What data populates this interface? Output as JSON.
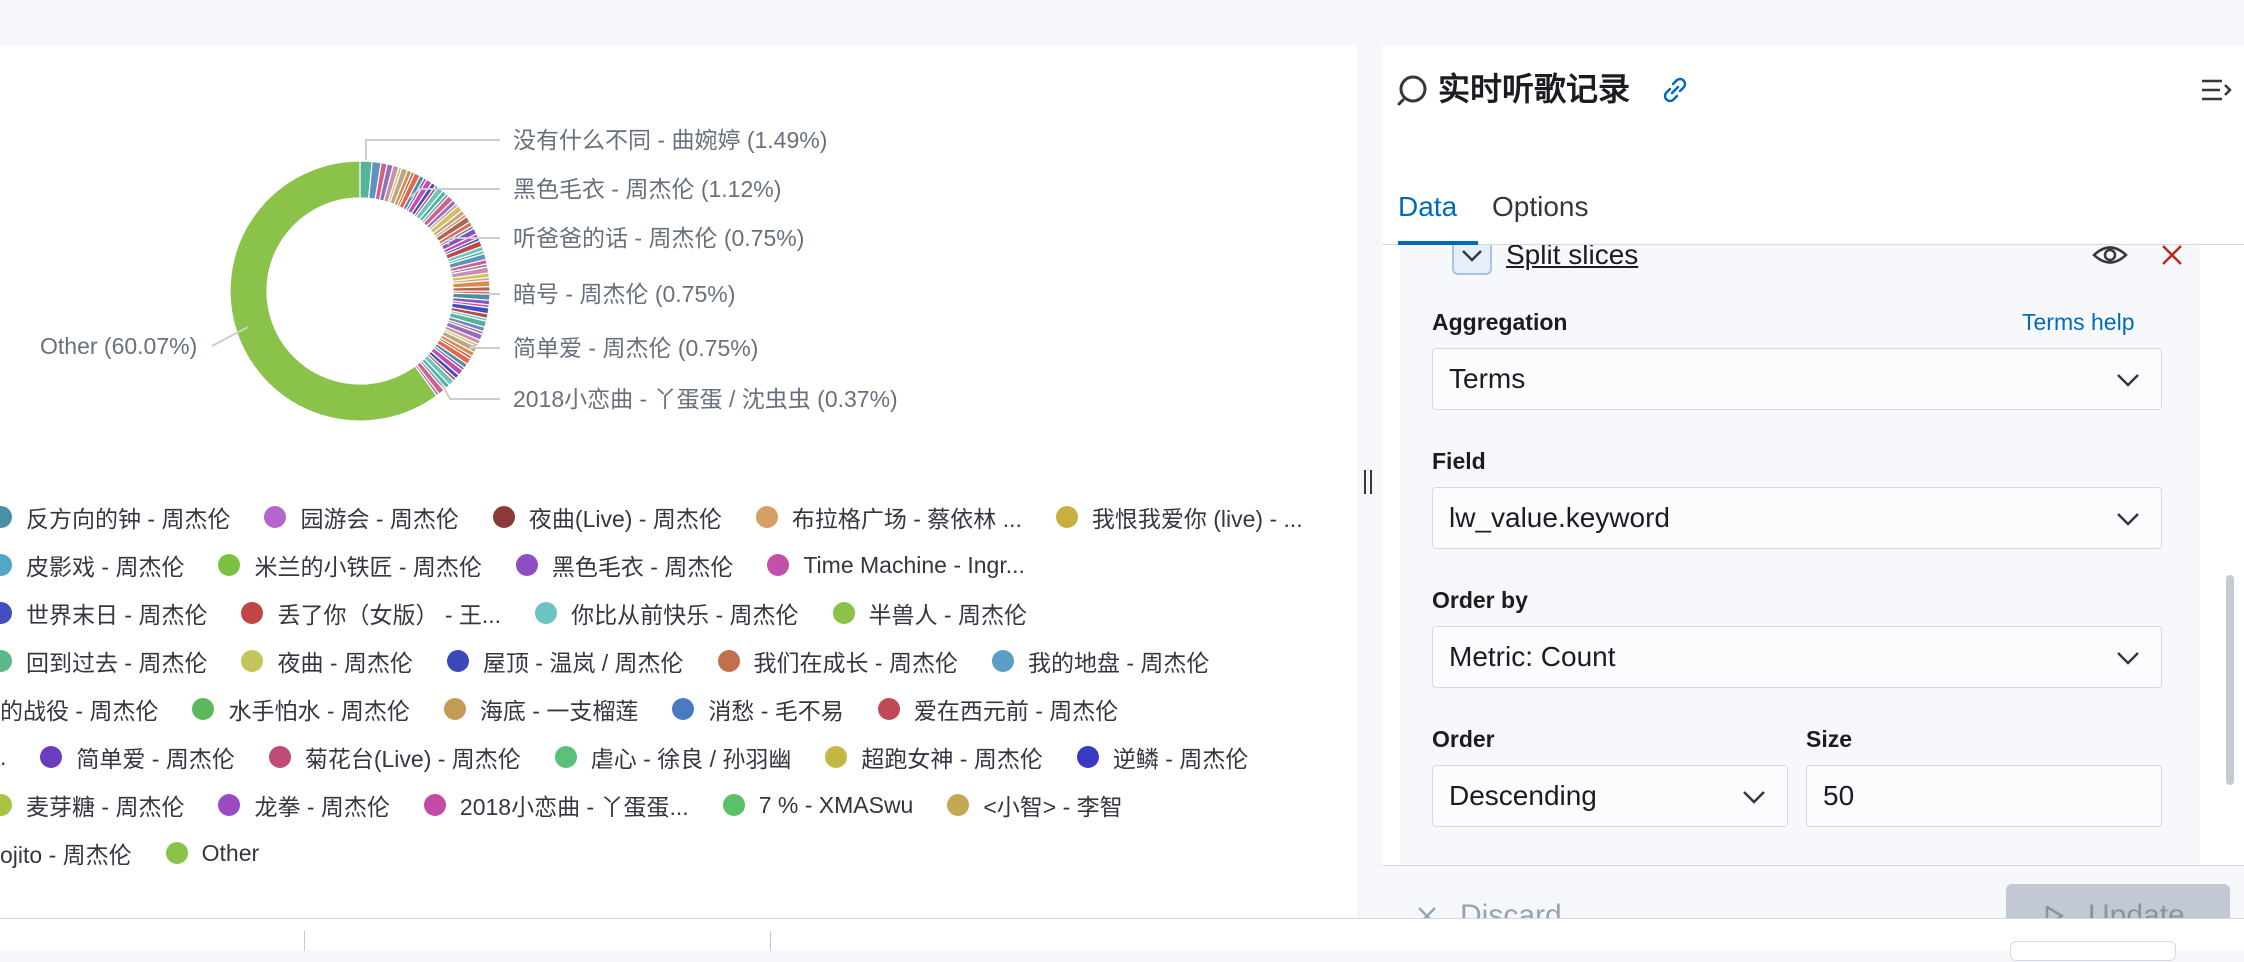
{
  "header": {
    "title": "实时听歌记录"
  },
  "tabs": [
    {
      "label": "Data",
      "active": true
    },
    {
      "label": "Options",
      "active": false
    }
  ],
  "agg_panel": {
    "title": "Split slices",
    "aggregation_label": "Aggregation",
    "aggregation_help": "Terms help",
    "aggregation_value": "Terms",
    "field_label": "Field",
    "field_value": "lw_value.keyword",
    "order_by_label": "Order by",
    "order_by_value": "Metric: Count",
    "order_label": "Order",
    "order_value": "Descending",
    "size_label": "Size",
    "size_value": "50"
  },
  "footer": {
    "discard_label": "Discard",
    "update_label": "Update"
  },
  "chart_data": {
    "type": "pie",
    "donut": true,
    "slices": [
      {
        "label": "Other",
        "percent": 60.07,
        "color": "#8bc34a"
      },
      {
        "label": "没有什么不同 - 曲婉婷",
        "percent": 1.49
      },
      {
        "label": "黑色毛衣 - 周杰伦",
        "percent": 1.12
      },
      {
        "label": "听爸爸的话 - 周杰伦",
        "percent": 0.75
      },
      {
        "label": "暗号 - 周杰伦",
        "percent": 0.75
      },
      {
        "label": "简单爱 - 周杰伦",
        "percent": 0.75
      },
      {
        "label": "2018小恋曲 - 丫蛋蛋 / 沈虫虫",
        "percent": 0.37
      }
    ],
    "callouts": [
      "Other (60.07%)",
      "没有什么不同 - 曲婉婷 (1.49%)",
      "黑色毛衣 - 周杰伦 (1.12%)",
      "听爸爸的话 - 周杰伦 (0.75%)",
      "暗号 - 周杰伦 (0.75%)",
      "简单爱 - 周杰伦 (0.75%)",
      "2018小恋曲 - 丫蛋蛋 / 沈虫虫 (0.37%)"
    ],
    "legend": [
      [
        {
          "label": "反方向的钟 - 周杰伦",
          "color": "#4a90a4"
        },
        {
          "label": "园游会 - 周杰伦",
          "color": "#b565c9"
        },
        {
          "label": "夜曲(Live) - 周杰伦",
          "color": "#8b3a3a"
        },
        {
          "label": "布拉格广场 - 蔡依林 ...",
          "color": "#d4a063"
        },
        {
          "label": "我恨我爱你 (live) - ...",
          "color": "#c7b040"
        }
      ],
      [
        {
          "label": "皮影戏 - 周杰伦",
          "color": "#54a7c4"
        },
        {
          "label": "米兰的小铁匠 - 周杰伦",
          "color": "#7cc242"
        },
        {
          "label": "黑色毛衣 - 周杰伦",
          "color": "#8e4fc0"
        },
        {
          "label": "Time Machine - Ingr...",
          "color": "#c050a8"
        }
      ],
      [
        {
          "label": "世界末日 - 周杰伦",
          "color": "#3f4fc0"
        },
        {
          "label": "丢了你（女版） - 王...",
          "color": "#c24545"
        },
        {
          "label": "你比从前快乐 - 周杰伦",
          "color": "#6cc4c0"
        },
        {
          "label": "半兽人 - 周杰伦",
          "color": "#8cc24a"
        }
      ],
      [
        {
          "label": "回到过去 - 周杰伦",
          "color": "#5cb88a"
        },
        {
          "label": "夜曲 - 周杰伦",
          "color": "#c4c45a"
        },
        {
          "label": "屋顶 - 温岚 / 周杰伦",
          "color": "#3d48b8"
        },
        {
          "label": "我们在成长 - 周杰伦",
          "color": "#c0704a"
        },
        {
          "label": "我的地盘 - 周杰伦",
          "color": "#5a9ec4"
        }
      ],
      [
        {
          "label": "的战役 - 周杰伦",
          "color": null
        },
        {
          "label": "水手怕水 - 周杰伦",
          "color": "#5cb85c"
        },
        {
          "label": "海底 - 一支榴莲",
          "color": "#c49a55"
        },
        {
          "label": "消愁 - 毛不易",
          "color": "#4a7ac4"
        },
        {
          "label": "爱在西元前 - 周杰伦",
          "color": "#c04a55"
        }
      ],
      [
        {
          "label": ".",
          "color": null
        },
        {
          "label": "简单爱 - 周杰伦",
          "color": "#6a3cc0"
        },
        {
          "label": "菊花台(Live) - 周杰伦",
          "color": "#c04a7a"
        },
        {
          "label": "虐心 - 徐良 / 孙羽幽",
          "color": "#5cbf7a"
        },
        {
          "label": "超跑女神 - 周杰伦",
          "color": "#c4b845"
        },
        {
          "label": "逆鳞 - 周杰伦",
          "color": "#3a3ac0"
        }
      ],
      [
        {
          "label": "麦芽糖 - 周杰伦",
          "color": "#a8c442"
        },
        {
          "label": "龙拳 - 周杰伦",
          "color": "#9a4ac4"
        },
        {
          "label": "2018小恋曲 - 丫蛋蛋...",
          "color": "#c44aa8"
        },
        {
          "label": "7 % - XMASwu",
          "color": "#5cbf6a"
        },
        {
          "label": "<小智> - 李智",
          "color": "#c4a855"
        }
      ],
      [
        {
          "label": "ojito - 周杰伦",
          "color": null
        },
        {
          "label": "Other",
          "color": "#8bc34a"
        }
      ]
    ]
  }
}
